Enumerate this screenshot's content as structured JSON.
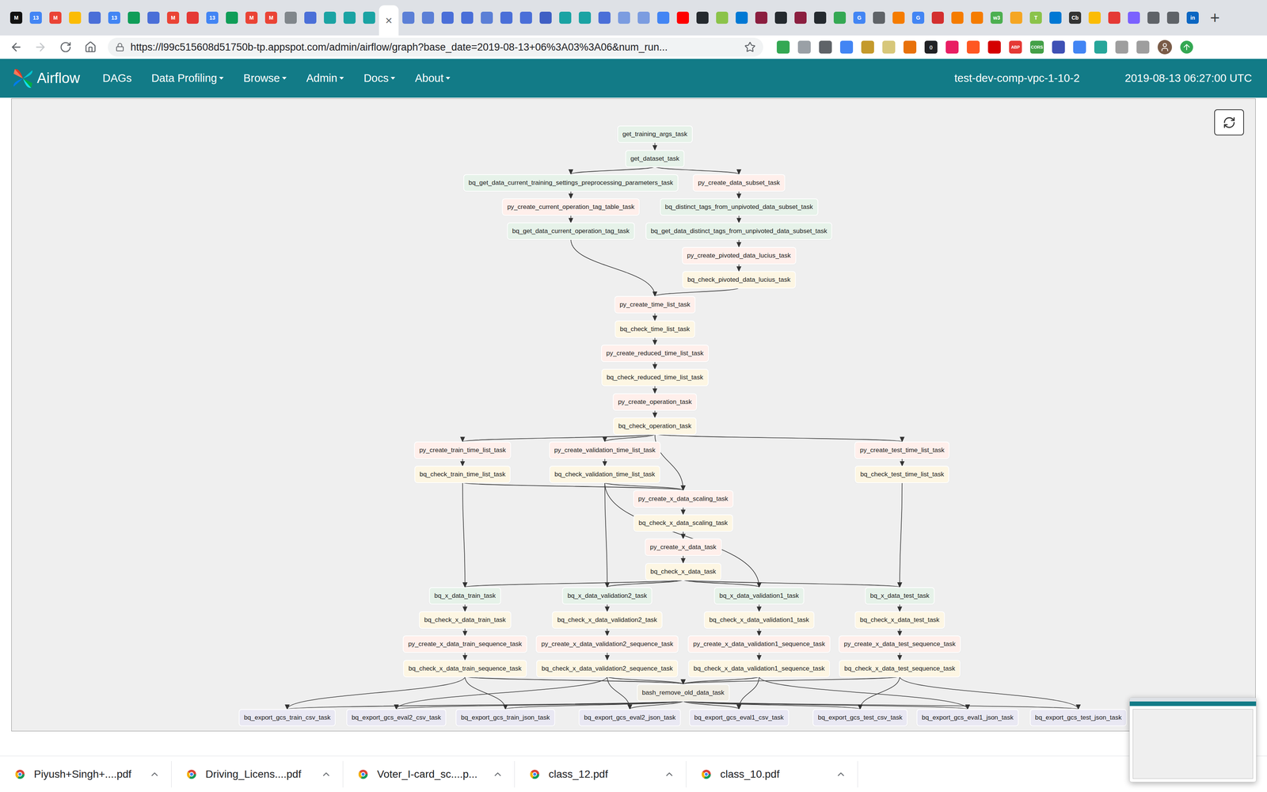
{
  "browser": {
    "tabs": [
      {
        "glyph": "M",
        "color": "#111111",
        "selected": false
      },
      {
        "glyph": "13",
        "color": "#4285f4",
        "selected": false
      },
      {
        "glyph": "M",
        "color": "#ea4335",
        "selected": false
      },
      {
        "glyph": "",
        "color": "#fbbc04",
        "selected": false
      },
      {
        "glyph": "",
        "color": "#4a6fd8",
        "selected": false
      },
      {
        "glyph": "13",
        "color": "#4285f4",
        "selected": false
      },
      {
        "glyph": "",
        "color": "#0f9d58",
        "selected": false
      },
      {
        "glyph": "",
        "color": "#4a6fd8",
        "selected": false
      },
      {
        "glyph": "M",
        "color": "#ea4335",
        "selected": false
      },
      {
        "glyph": "",
        "color": "#e53935",
        "selected": false
      },
      {
        "glyph": "13",
        "color": "#4285f4",
        "selected": false
      },
      {
        "glyph": "",
        "color": "#0f9d58",
        "selected": false
      },
      {
        "glyph": "M",
        "color": "#ea4335",
        "selected": false
      },
      {
        "glyph": "M",
        "color": "#ea4335",
        "selected": false
      },
      {
        "glyph": "",
        "color": "#80868b",
        "selected": false
      },
      {
        "glyph": "",
        "color": "#4a6fd8",
        "selected": false
      },
      {
        "glyph": "",
        "color": "#1aa3a3",
        "selected": false
      },
      {
        "glyph": "",
        "color": "#1aa3a3",
        "selected": false
      },
      {
        "glyph": "",
        "color": "#1aa3a3",
        "selected": false
      },
      {
        "glyph": "×",
        "color": "#5f6368",
        "selected": true
      },
      {
        "glyph": "",
        "color": "#5b7fd6",
        "selected": false
      },
      {
        "glyph": "",
        "color": "#5b7fd6",
        "selected": false
      },
      {
        "glyph": "",
        "color": "#4a6fd8",
        "selected": false
      },
      {
        "glyph": "",
        "color": "#4a6fd8",
        "selected": false
      },
      {
        "glyph": "",
        "color": "#5b7fd6",
        "selected": false
      },
      {
        "glyph": "",
        "color": "#4a6fd8",
        "selected": false
      },
      {
        "glyph": "",
        "color": "#4a6fd8",
        "selected": false
      },
      {
        "glyph": "",
        "color": "#3f5fc4",
        "selected": false
      },
      {
        "glyph": "",
        "color": "#1aa3a3",
        "selected": false
      },
      {
        "glyph": "",
        "color": "#1aa3a3",
        "selected": false
      },
      {
        "glyph": "",
        "color": "#4a6fd8",
        "selected": false
      },
      {
        "glyph": "",
        "color": "#7b9ce0",
        "selected": false
      },
      {
        "glyph": "",
        "color": "#7b9ce0",
        "selected": false
      },
      {
        "glyph": "",
        "color": "#4285f4",
        "selected": false
      },
      {
        "glyph": "",
        "color": "#ff0000",
        "selected": false
      },
      {
        "glyph": "",
        "color": "#24292e",
        "selected": false
      },
      {
        "glyph": "",
        "color": "#8bc34a",
        "selected": false
      },
      {
        "glyph": "",
        "color": "#0078d4",
        "selected": false
      },
      {
        "glyph": "",
        "color": "#8b1e3f",
        "selected": false
      },
      {
        "glyph": "",
        "color": "#24292e",
        "selected": false
      },
      {
        "glyph": "",
        "color": "#8b1e3f",
        "selected": false
      },
      {
        "glyph": "",
        "color": "#24292e",
        "selected": false
      },
      {
        "glyph": "",
        "color": "#34a853",
        "selected": false
      },
      {
        "glyph": "G",
        "color": "#4285f4",
        "selected": false
      },
      {
        "glyph": "",
        "color": "#5f6368",
        "selected": false
      },
      {
        "glyph": "",
        "color": "#f57c00",
        "selected": false
      },
      {
        "glyph": "G",
        "color": "#4285f4",
        "selected": false
      },
      {
        "glyph": "",
        "color": "#d32f2f",
        "selected": false
      },
      {
        "glyph": "",
        "color": "#f57c00",
        "selected": false
      },
      {
        "glyph": "",
        "color": "#f57c00",
        "selected": false
      },
      {
        "glyph": "w3",
        "color": "#4caf50",
        "selected": false
      },
      {
        "glyph": "",
        "color": "#f5a623",
        "selected": false
      },
      {
        "glyph": "T",
        "color": "#8bc34a",
        "selected": false
      },
      {
        "glyph": "",
        "color": "#0078d4",
        "selected": false
      },
      {
        "glyph": "Cb",
        "color": "#333333",
        "selected": false
      },
      {
        "glyph": "",
        "color": "#fbbc04",
        "selected": false
      },
      {
        "glyph": "",
        "color": "#e53935",
        "selected": false
      },
      {
        "glyph": "",
        "color": "#7b61ff",
        "selected": false
      },
      {
        "glyph": "",
        "color": "#5f6368",
        "selected": false
      },
      {
        "glyph": "",
        "color": "#5f6368",
        "selected": false
      },
      {
        "glyph": "in",
        "color": "#0a66c2",
        "selected": false
      }
    ],
    "new_tab": "+",
    "back_enabled": true,
    "forward_enabled": false,
    "url": "https://l99c515608d51750b-tp.appspot.com/admin/airflow/graph?base_date=2019-08-13+06%3A03%3A06&num_run...",
    "extensions": [
      {
        "glyph": "",
        "color": "#34a853"
      },
      {
        "glyph": "",
        "color": "#9aa0a6"
      },
      {
        "glyph": "",
        "color": "#5f6368"
      },
      {
        "glyph": "",
        "color": "#4285f4"
      },
      {
        "glyph": "",
        "color": "#c49a2c"
      },
      {
        "glyph": "",
        "color": "#d7c77a"
      },
      {
        "glyph": "",
        "color": "#e8710a"
      },
      {
        "glyph": "{}",
        "color": "#202124"
      },
      {
        "glyph": "",
        "color": "#e91e63"
      },
      {
        "glyph": "",
        "color": "#ff5722"
      },
      {
        "glyph": "",
        "color": "#d50000"
      },
      {
        "glyph": "ABP",
        "color": "#e53935"
      },
      {
        "glyph": "CORS",
        "color": "#43a047"
      },
      {
        "glyph": "",
        "color": "#3f51b5"
      },
      {
        "glyph": "",
        "color": "#4285f4"
      },
      {
        "glyph": "",
        "color": "#26a69a"
      },
      {
        "glyph": "",
        "color": "#9e9e9e"
      },
      {
        "glyph": "",
        "color": "#9e9e9e"
      }
    ]
  },
  "navbar": {
    "brand": "Airflow",
    "menu": [
      {
        "label": "DAGs",
        "dropdown": false
      },
      {
        "label": "Data Profiling",
        "dropdown": true
      },
      {
        "label": "Browse",
        "dropdown": true
      },
      {
        "label": "Admin",
        "dropdown": true
      },
      {
        "label": "Docs",
        "dropdown": true
      },
      {
        "label": "About",
        "dropdown": true
      }
    ],
    "environment": "test-dev-comp-vpc-1-10-2",
    "clock": "2019-08-13 06:27:00 UTC"
  },
  "graph": {
    "nodes": [
      {
        "label": "get_training_args_task",
        "color": "#e6f2e9"
      },
      {
        "label": "get_dataset_task",
        "color": "#e6f2e9"
      },
      {
        "label": "bq_get_data_current_training_settings_preprocessing_parameters_task",
        "color": "#e6f2e9"
      },
      {
        "label": "py_create_data_subset_task",
        "color": "#ffefeb"
      },
      {
        "label": "py_create_current_operation_tag_table_task",
        "color": "#ffefeb"
      },
      {
        "label": "bq_distinct_tags_from_unpivoted_data_subset_task",
        "color": "#e6f2e9"
      },
      {
        "label": "bq_get_data_current_operation_tag_task",
        "color": "#e6f2e9"
      },
      {
        "label": "bq_get_data_distinct_tags_from_unpivoted_data_subset_task",
        "color": "#e6f2e9"
      },
      {
        "label": "py_create_pivoted_data_lucius_task",
        "color": "#ffefeb"
      },
      {
        "label": "bq_check_pivoted_data_lucius_task",
        "color": "#fdf6e3"
      },
      {
        "label": "py_create_time_list_task",
        "color": "#ffefeb"
      },
      {
        "label": "bq_check_time_list_task",
        "color": "#fdf6e3"
      },
      {
        "label": "py_create_reduced_time_list_task",
        "color": "#ffefeb"
      },
      {
        "label": "bq_check_reduced_time_list_task",
        "color": "#fdf6e3"
      },
      {
        "label": "py_create_operation_task",
        "color": "#ffefeb"
      },
      {
        "label": "bq_check_operation_task",
        "color": "#fdf6e3"
      },
      {
        "label": "py_create_train_time_list_task",
        "color": "#ffefeb"
      },
      {
        "label": "py_create_validation_time_list_task",
        "color": "#ffefeb"
      },
      {
        "label": "py_create_test_time_list_task",
        "color": "#ffefeb"
      },
      {
        "label": "bq_check_train_time_list_task",
        "color": "#fdf6e3"
      },
      {
        "label": "bq_check_validation_time_list_task",
        "color": "#fdf6e3"
      },
      {
        "label": "bq_check_test_time_list_task",
        "color": "#fdf6e3"
      },
      {
        "label": "py_create_x_data_scaling_task",
        "color": "#ffefeb"
      },
      {
        "label": "bq_check_x_data_scaling_task",
        "color": "#fdf6e3"
      },
      {
        "label": "py_create_x_data_task",
        "color": "#ffefeb"
      },
      {
        "label": "bq_check_x_data_task",
        "color": "#fdf6e3"
      },
      {
        "label": "bq_x_data_train_task",
        "color": "#e6f2e9"
      },
      {
        "label": "bq_x_data_validation2_task",
        "color": "#e6f2e9"
      },
      {
        "label": "bq_x_data_validation1_task",
        "color": "#e6f2e9"
      },
      {
        "label": "bq_x_data_test_task",
        "color": "#e6f2e9"
      },
      {
        "label": "bq_check_x_data_train_task",
        "color": "#fdf6e3"
      },
      {
        "label": "bq_check_x_data_validation2_task",
        "color": "#fdf6e3"
      },
      {
        "label": "bq_check_x_data_validation1_task",
        "color": "#fdf6e3"
      },
      {
        "label": "bq_check_x_data_test_task",
        "color": "#fdf6e3"
      },
      {
        "label": "py_create_x_data_train_sequence_task",
        "color": "#ffefeb"
      },
      {
        "label": "py_create_x_data_validation2_sequence_task",
        "color": "#ffefeb"
      },
      {
        "label": "py_create_x_data_validation1_sequence_task",
        "color": "#ffefeb"
      },
      {
        "label": "py_create_x_data_test_sequence_task",
        "color": "#ffefeb"
      },
      {
        "label": "bq_check_x_data_train_sequence_task",
        "color": "#fdf6e3"
      },
      {
        "label": "bq_check_x_data_validation2_sequence_task",
        "color": "#fdf6e3"
      },
      {
        "label": "bq_check_x_data_validation1_sequence_task",
        "color": "#fdf6e3"
      },
      {
        "label": "bq_check_x_data_test_sequence_task",
        "color": "#fdf6e3"
      },
      {
        "label": "bash_remove_old_data_task",
        "color": "#f0ede4"
      },
      {
        "label": "bq_export_gcs_train_csv_task",
        "color": "#e9e8f3"
      },
      {
        "label": "bq_export_gcs_eval2_csv_task",
        "color": "#e9e8f3"
      },
      {
        "label": "bq_export_gcs_train_json_task",
        "color": "#e9e8f3"
      },
      {
        "label": "bq_export_gcs_eval2_json_task",
        "color": "#e9e8f3"
      },
      {
        "label": "bq_export_gcs_eval1_csv_task",
        "color": "#e9e8f3"
      },
      {
        "label": "bq_export_gcs_test_csv_task",
        "color": "#e9e8f3"
      },
      {
        "label": "bq_export_gcs_eval1_json_task",
        "color": "#e9e8f3"
      },
      {
        "label": "bq_export_gcs_test_json_task",
        "color": "#e9e8f3"
      }
    ],
    "edges": [
      [
        0,
        1
      ],
      [
        1,
        2
      ],
      [
        1,
        3
      ],
      [
        2,
        4
      ],
      [
        4,
        6
      ],
      [
        3,
        5
      ],
      [
        5,
        7
      ],
      [
        7,
        8
      ],
      [
        8,
        9
      ],
      [
        6,
        10
      ],
      [
        9,
        10
      ],
      [
        10,
        11
      ],
      [
        11,
        12
      ],
      [
        12,
        13
      ],
      [
        13,
        14
      ],
      [
        14,
        15
      ],
      [
        15,
        16
      ],
      [
        15,
        17
      ],
      [
        15,
        18
      ],
      [
        15,
        22
      ],
      [
        16,
        19
      ],
      [
        17,
        20
      ],
      [
        18,
        21
      ],
      [
        19,
        22
      ],
      [
        20,
        22
      ],
      [
        19,
        26
      ],
      [
        20,
        27
      ],
      [
        20,
        28
      ],
      [
        21,
        29
      ],
      [
        22,
        23
      ],
      [
        23,
        24
      ],
      [
        24,
        25
      ],
      [
        25,
        26
      ],
      [
        25,
        27
      ],
      [
        25,
        28
      ],
      [
        25,
        29
      ],
      [
        26,
        30
      ],
      [
        27,
        31
      ],
      [
        28,
        32
      ],
      [
        29,
        33
      ],
      [
        30,
        34
      ],
      [
        31,
        35
      ],
      [
        32,
        36
      ],
      [
        33,
        37
      ],
      [
        34,
        38
      ],
      [
        35,
        39
      ],
      [
        36,
        40
      ],
      [
        37,
        41
      ],
      [
        38,
        42
      ],
      [
        39,
        42
      ],
      [
        40,
        42
      ],
      [
        41,
        42
      ],
      [
        38,
        43
      ],
      [
        38,
        45
      ],
      [
        39,
        44
      ],
      [
        39,
        46
      ],
      [
        40,
        47
      ],
      [
        40,
        49
      ],
      [
        41,
        48
      ],
      [
        41,
        50
      ],
      [
        42,
        43
      ],
      [
        42,
        44
      ],
      [
        42,
        45
      ],
      [
        42,
        46
      ],
      [
        42,
        47
      ],
      [
        42,
        48
      ],
      [
        42,
        49
      ],
      [
        42,
        50
      ]
    ]
  },
  "downloads": [
    {
      "name": "Piyush+Singh+....pdf"
    },
    {
      "name": "Driving_Licens....pdf"
    },
    {
      "name": "Voter_I-card_sc....p..."
    },
    {
      "name": "class_12.pdf"
    },
    {
      "name": "class_10.pdf"
    }
  ]
}
